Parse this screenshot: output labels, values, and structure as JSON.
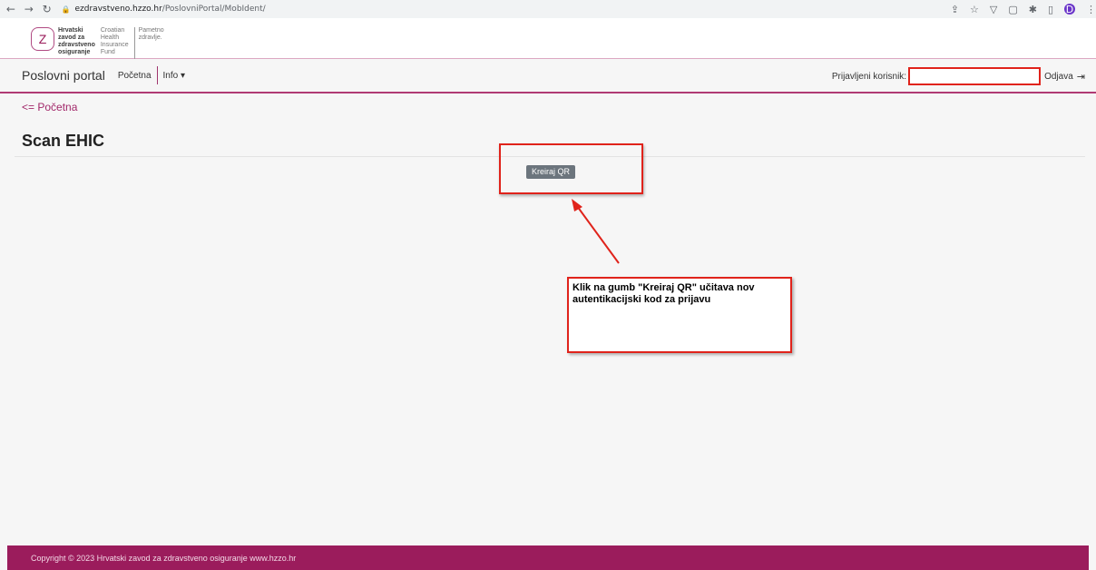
{
  "browser": {
    "url_domain": "ezdravstveno.hzzo.hr",
    "url_path": "/PoslovniPortal/MobIdent/",
    "profile_initial": "D"
  },
  "logo": {
    "hr_lines": [
      "Hrvatski",
      "zavod za",
      "zdravstveno",
      "osiguranje"
    ],
    "en_lines": [
      "Croatian",
      "Health",
      "Insurance",
      "Fund"
    ],
    "tag_lines": [
      "Pametno",
      "zdravlje."
    ]
  },
  "nav": {
    "brand": "Poslovni portal",
    "home_link": "Početna",
    "info_menu": "Info ▾",
    "user_label": "Prijavljeni korisnik:",
    "user_value": "",
    "logout": "Odjava"
  },
  "main": {
    "back_link": "<= Početna",
    "title": "Scan EHIC",
    "qr_button": "Kreiraj QR"
  },
  "annotation": {
    "text": "Klik na gumb \"Kreiraj QR\" učitava nov autentikacijski kod za prijavu"
  },
  "footer": {
    "text": "Copyright © 2023 Hrvatski zavod za zdravstveno osiguranje www.hzzo.hr"
  },
  "colors": {
    "brand": "#9b1c5c",
    "annotation": "#e0231b",
    "button": "#6c757d"
  }
}
